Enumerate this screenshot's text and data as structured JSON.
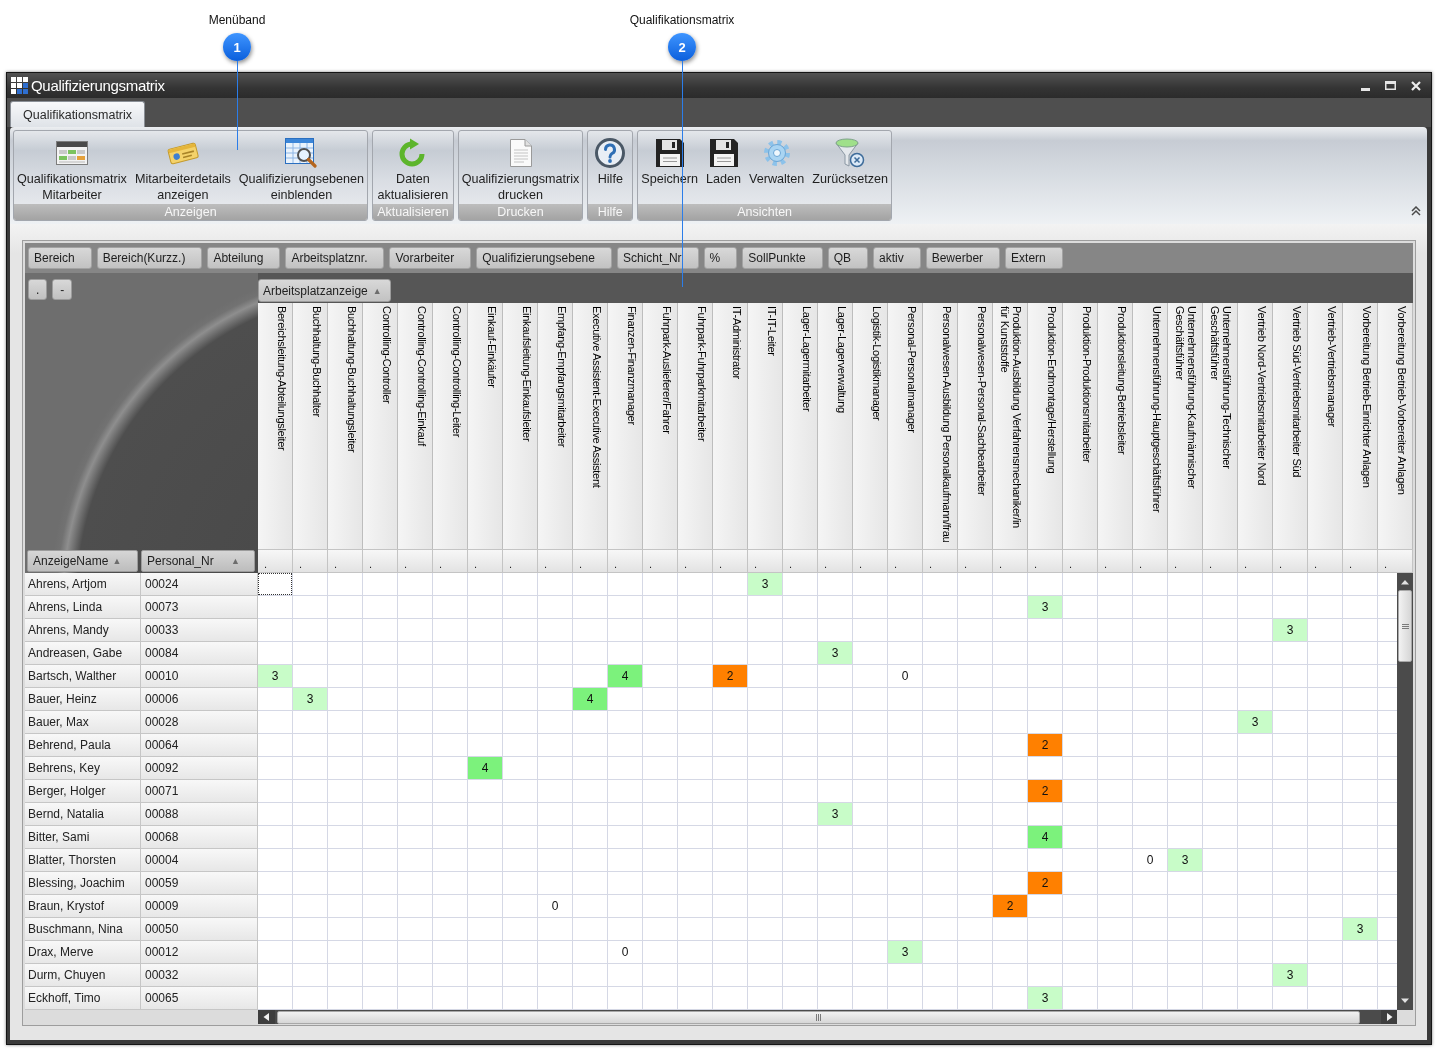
{
  "callouts": [
    {
      "label": "Menüband",
      "number": "1"
    },
    {
      "label": "Qualifikationsmatrix",
      "number": "2"
    }
  ],
  "window": {
    "title": "Qualifizierungsmatrix"
  },
  "tabs": [
    {
      "label": "Qualifikationsmatrix",
      "selected": true
    }
  ],
  "ribbon": {
    "groups": [
      {
        "label": "Anzeigen",
        "buttons": [
          "Qualifikationsmatrix Mitarbeiter",
          "Mitarbeiterdetails anzeigen",
          "Qualifizierungsebenen einblenden"
        ]
      },
      {
        "label": "Aktualisieren",
        "buttons": [
          "Daten aktualisieren"
        ]
      },
      {
        "label": "Drucken",
        "buttons": [
          "Qualifizierungsmatrix drucken"
        ]
      },
      {
        "label": "Hilfe",
        "buttons": [
          "Hilfe"
        ]
      },
      {
        "label": "Ansichten",
        "buttons": [
          "Speichern",
          "Laden",
          "Verwalten",
          "Zurücksetzen"
        ]
      }
    ]
  },
  "group_by_fields": [
    "Bereich",
    "Bereich(Kurzz.)",
    "Abteilung",
    "Arbeitsplatznr.",
    "Vorarbeiter",
    "Qualifizierungsebene",
    "Schicht_Nr",
    "%",
    "SollPunkte",
    "QB",
    "aktiv",
    "Bewerber",
    "Extern"
  ],
  "matrix": {
    "corner_buttons": [
      ".",
      "-"
    ],
    "column_group": {
      "label": "Arbeitsplatzanzeige",
      "sort_mark": "▲"
    },
    "row_columns": [
      {
        "label": "AnzeigeName",
        "sort_mark": "▲"
      },
      {
        "label": "Personal_Nr",
        "sort_mark": "▲"
      }
    ],
    "columns": [
      {
        "label": "Bereichsleitung-Abteilungsleiter",
        "filter": "."
      },
      {
        "label": "Buchhaltung-Buchhalter",
        "filter": "."
      },
      {
        "label": "Buchhaltung-Buchhaltungsleiter",
        "filter": "."
      },
      {
        "label": "Controlling-Controller",
        "filter": "."
      },
      {
        "label": "Controlling-Controlling-Einkauf",
        "filter": "."
      },
      {
        "label": "Controlling-Controlling-Leiter",
        "filter": "."
      },
      {
        "label": "Einkauf-Einkäufer",
        "filter": "."
      },
      {
        "label": "Einkaufsleitung-Einkaufsleiter",
        "filter": "."
      },
      {
        "label": "Empfang-Empfangsmitarbeiter",
        "filter": "."
      },
      {
        "label": "Executive Assistent-Executive Assistent",
        "filter": "."
      },
      {
        "label": "Finanzen-Finanzmanager",
        "filter": "."
      },
      {
        "label": "Fuhrpark-Auslieferer/Fahrer",
        "filter": "."
      },
      {
        "label": "Fuhrpark-Fuhrparkmitarbeiter",
        "filter": "."
      },
      {
        "label": "IT-Administrator",
        "filter": "."
      },
      {
        "label": "IT-IT-Leiter",
        "filter": "."
      },
      {
        "label": "Lager-Lagermitarbeiter",
        "filter": "."
      },
      {
        "label": "Lager-Lagerverwaltung",
        "filter": "."
      },
      {
        "label": "Logistik-Logistikmanager",
        "filter": "."
      },
      {
        "label": "Personal-Personalmanager",
        "filter": "."
      },
      {
        "label": "Personalwesen-Ausbildung Personalkaufmann/frau",
        "filter": "."
      },
      {
        "label": "Personalwesen-Personal-Sachbearbeiter",
        "filter": "."
      },
      {
        "label": "Produktion-Ausbildung Verfahrensmechaniker/in\nfür Kunststoffe",
        "filter": "."
      },
      {
        "label": "Produktion-Endmontage/Herstellung",
        "filter": "."
      },
      {
        "label": "Produktion-Produktionsmitarbeiter",
        "filter": "."
      },
      {
        "label": "Produktionsleitung-Betriebsleiter",
        "filter": "."
      },
      {
        "label": "Unternehmensführung-Hauptgeschäftsführer",
        "filter": "."
      },
      {
        "label": "Unternehmensführung-Kaufmännischer\nGeschäftsführer",
        "filter": "."
      },
      {
        "label": "Unternehmensführung-Technischer\nGeschäftsführer",
        "filter": "."
      },
      {
        "label": "Vertrieb Nord-Vertriebsmitarbeiter Nord",
        "filter": "."
      },
      {
        "label": "Vertrieb Süd-Vertriebsmitarbeiter Süd",
        "filter": "."
      },
      {
        "label": "Vertrieb-Vertriebsmanager",
        "filter": "."
      },
      {
        "label": "Vorbereitung Betrieb-Einrichter Anlagen",
        "filter": "."
      },
      {
        "label": "Vorbereitung Betrieb-Vorbereiter Anlagen",
        "filter": "."
      }
    ],
    "rows": [
      {
        "name": "Ahrens, Artjom",
        "personal_nr": "00024",
        "cells": [
          {
            "selected": true
          },
          null,
          null,
          null,
          null,
          null,
          null,
          null,
          null,
          null,
          null,
          null,
          null,
          null,
          {
            "value": "3",
            "color": "#c8fcc8",
            "selected": false
          },
          null,
          null,
          null,
          null,
          null,
          null,
          null,
          null,
          null,
          null,
          null,
          null,
          null,
          null,
          null,
          null,
          null,
          null
        ]
      },
      {
        "name": "Ahrens, Linda",
        "personal_nr": "00073",
        "cells": [
          null,
          null,
          null,
          null,
          null,
          null,
          null,
          null,
          null,
          null,
          null,
          null,
          null,
          null,
          null,
          null,
          null,
          null,
          null,
          null,
          null,
          null,
          {
            "value": "3",
            "color": "#c8fcc8",
            "selected": false
          },
          null,
          null,
          null,
          null,
          null,
          null,
          null,
          null,
          null,
          null
        ]
      },
      {
        "name": "Ahrens, Mandy",
        "personal_nr": "00033",
        "cells": [
          null,
          null,
          null,
          null,
          null,
          null,
          null,
          null,
          null,
          null,
          null,
          null,
          null,
          null,
          null,
          null,
          null,
          null,
          null,
          null,
          null,
          null,
          null,
          null,
          null,
          null,
          null,
          null,
          null,
          {
            "value": "3",
            "color": "#c8fcc8",
            "selected": false
          },
          null,
          null,
          null
        ]
      },
      {
        "name": "Andreasen, Gabe",
        "personal_nr": "00084",
        "cells": [
          null,
          null,
          null,
          null,
          null,
          null,
          null,
          null,
          null,
          null,
          null,
          null,
          null,
          null,
          null,
          null,
          {
            "value": "3",
            "color": "#c8fcc8",
            "selected": false
          },
          null,
          null,
          null,
          null,
          null,
          null,
          null,
          null,
          null,
          null,
          null,
          null,
          null,
          null,
          null,
          null
        ]
      },
      {
        "name": "Bartsch, Walther",
        "personal_nr": "00010",
        "cells": [
          {
            "value": "3",
            "color": "#c8fcc8",
            "selected": false
          },
          null,
          null,
          null,
          null,
          null,
          null,
          null,
          null,
          null,
          {
            "value": "4",
            "color": "#7cf27c",
            "selected": false
          },
          null,
          null,
          {
            "value": "2",
            "color": "#ff8000",
            "selected": false
          },
          null,
          null,
          null,
          null,
          {
            "value": "0",
            "selected": false
          },
          null,
          null,
          null,
          null,
          null,
          null,
          null,
          null,
          null,
          null,
          null,
          null,
          null,
          null
        ]
      },
      {
        "name": "Bauer, Heinz",
        "personal_nr": "00006",
        "cells": [
          null,
          {
            "value": "3",
            "color": "#c8fcc8",
            "selected": false
          },
          null,
          null,
          null,
          null,
          null,
          null,
          null,
          {
            "value": "4",
            "color": "#7cf27c",
            "selected": false
          },
          null,
          null,
          null,
          null,
          null,
          null,
          null,
          null,
          null,
          null,
          null,
          null,
          null,
          null,
          null,
          null,
          null,
          null,
          null,
          null,
          null,
          null,
          null
        ]
      },
      {
        "name": "Bauer, Max",
        "personal_nr": "00028",
        "cells": [
          null,
          null,
          null,
          null,
          null,
          null,
          null,
          null,
          null,
          null,
          null,
          null,
          null,
          null,
          null,
          null,
          null,
          null,
          null,
          null,
          null,
          null,
          null,
          null,
          null,
          null,
          null,
          null,
          {
            "value": "3",
            "color": "#c8fcc8",
            "selected": false
          },
          null,
          null,
          null,
          null
        ]
      },
      {
        "name": "Behrend, Paula",
        "personal_nr": "00064",
        "cells": [
          null,
          null,
          null,
          null,
          null,
          null,
          null,
          null,
          null,
          null,
          null,
          null,
          null,
          null,
          null,
          null,
          null,
          null,
          null,
          null,
          null,
          null,
          {
            "value": "2",
            "color": "#ff8000",
            "selected": false
          },
          null,
          null,
          null,
          null,
          null,
          null,
          null,
          null,
          null,
          null
        ]
      },
      {
        "name": "Behrens, Key",
        "personal_nr": "00092",
        "cells": [
          null,
          null,
          null,
          null,
          null,
          null,
          {
            "value": "4",
            "color": "#7cf27c",
            "selected": false
          },
          null,
          null,
          null,
          null,
          null,
          null,
          null,
          null,
          null,
          null,
          null,
          null,
          null,
          null,
          null,
          null,
          null,
          null,
          null,
          null,
          null,
          null,
          null,
          null,
          null,
          null
        ]
      },
      {
        "name": "Berger, Holger",
        "personal_nr": "00071",
        "cells": [
          null,
          null,
          null,
          null,
          null,
          null,
          null,
          null,
          null,
          null,
          null,
          null,
          null,
          null,
          null,
          null,
          null,
          null,
          null,
          null,
          null,
          null,
          {
            "value": "2",
            "color": "#ff8000",
            "selected": false
          },
          null,
          null,
          null,
          null,
          null,
          null,
          null,
          null,
          null,
          null
        ]
      },
      {
        "name": "Bernd, Natalia",
        "personal_nr": "00088",
        "cells": [
          null,
          null,
          null,
          null,
          null,
          null,
          null,
          null,
          null,
          null,
          null,
          null,
          null,
          null,
          null,
          null,
          {
            "value": "3",
            "color": "#c8fcc8",
            "selected": false
          },
          null,
          null,
          null,
          null,
          null,
          null,
          null,
          null,
          null,
          null,
          null,
          null,
          null,
          null,
          null,
          null
        ]
      },
      {
        "name": "Bitter, Sami",
        "personal_nr": "00068",
        "cells": [
          null,
          null,
          null,
          null,
          null,
          null,
          null,
          null,
          null,
          null,
          null,
          null,
          null,
          null,
          null,
          null,
          null,
          null,
          null,
          null,
          null,
          null,
          {
            "value": "4",
            "color": "#7cf27c",
            "selected": false
          },
          null,
          null,
          null,
          null,
          null,
          null,
          null,
          null,
          null,
          null
        ]
      },
      {
        "name": "Blatter, Thorsten",
        "personal_nr": "00004",
        "cells": [
          null,
          null,
          null,
          null,
          null,
          null,
          null,
          null,
          null,
          null,
          null,
          null,
          null,
          null,
          null,
          null,
          null,
          null,
          null,
          null,
          null,
          null,
          null,
          null,
          null,
          {
            "value": "0",
            "selected": false
          },
          {
            "value": "3",
            "color": "#c8fcc8",
            "selected": false
          },
          null,
          null,
          null,
          null,
          null,
          null
        ]
      },
      {
        "name": "Blessing, Joachim",
        "personal_nr": "00059",
        "cells": [
          null,
          null,
          null,
          null,
          null,
          null,
          null,
          null,
          null,
          null,
          null,
          null,
          null,
          null,
          null,
          null,
          null,
          null,
          null,
          null,
          null,
          null,
          {
            "value": "2",
            "color": "#ff8000",
            "selected": false
          },
          null,
          null,
          null,
          null,
          null,
          null,
          null,
          null,
          null,
          null
        ]
      },
      {
        "name": "Braun, Krystof",
        "personal_nr": "00009",
        "cells": [
          null,
          null,
          null,
          null,
          null,
          null,
          null,
          null,
          {
            "value": "0",
            "selected": false
          },
          null,
          null,
          null,
          null,
          null,
          null,
          null,
          null,
          null,
          null,
          null,
          null,
          {
            "value": "2",
            "color": "#ff8000",
            "selected": false
          },
          null,
          null,
          null,
          null,
          null,
          null,
          null,
          null,
          null,
          null,
          null
        ]
      },
      {
        "name": "Buschmann, Nina",
        "personal_nr": "00050",
        "cells": [
          null,
          null,
          null,
          null,
          null,
          null,
          null,
          null,
          null,
          null,
          null,
          null,
          null,
          null,
          null,
          null,
          null,
          null,
          null,
          null,
          null,
          null,
          null,
          null,
          null,
          null,
          null,
          null,
          null,
          null,
          null,
          {
            "value": "3",
            "color": "#c8fcc8",
            "selected": false
          },
          null
        ]
      },
      {
        "name": "Drax, Merve",
        "personal_nr": "00012",
        "cells": [
          null,
          null,
          null,
          null,
          null,
          null,
          null,
          null,
          null,
          null,
          {
            "value": "0",
            "selected": false
          },
          null,
          null,
          null,
          null,
          null,
          null,
          null,
          {
            "value": "3",
            "color": "#c8fcc8",
            "selected": false
          },
          null,
          null,
          null,
          null,
          null,
          null,
          null,
          null,
          null,
          null,
          null,
          null,
          null,
          null
        ]
      },
      {
        "name": "Durm, Chuyen",
        "personal_nr": "00032",
        "cells": [
          null,
          null,
          null,
          null,
          null,
          null,
          null,
          null,
          null,
          null,
          null,
          null,
          null,
          null,
          null,
          null,
          null,
          null,
          null,
          null,
          null,
          null,
          null,
          null,
          null,
          null,
          null,
          null,
          null,
          {
            "value": "3",
            "color": "#c8fcc8",
            "selected": false
          },
          null,
          null,
          null
        ]
      },
      {
        "name": "Eckhoff, Timo",
        "personal_nr": "00065",
        "cells": [
          null,
          null,
          null,
          null,
          null,
          null,
          null,
          null,
          null,
          null,
          null,
          null,
          null,
          null,
          null,
          null,
          null,
          null,
          null,
          null,
          null,
          null,
          {
            "value": "3",
            "color": "#c8fcc8",
            "selected": false
          },
          null,
          null,
          null,
          null,
          null,
          null,
          null,
          null,
          null,
          null
        ]
      }
    ]
  }
}
